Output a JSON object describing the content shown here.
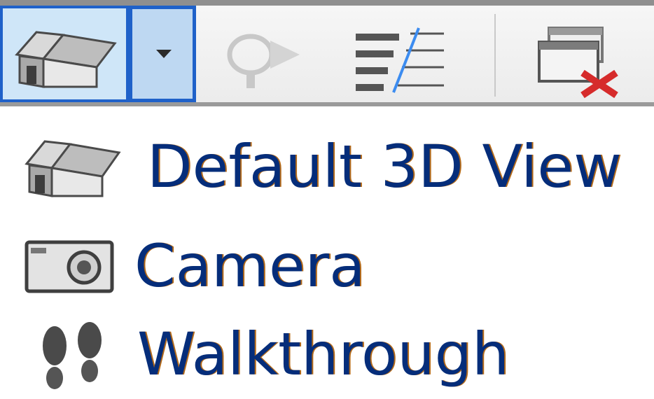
{
  "toolbar": {
    "buttons": [
      {
        "icon": "house-icon",
        "active": true
      },
      {
        "icon": "dropdown-arrow-icon",
        "active": true
      },
      {
        "icon": "section-view-icon",
        "enabled": false
      },
      {
        "icon": "thin-lines-icon"
      },
      {
        "icon": "close-hidden-windows-icon"
      }
    ]
  },
  "menu": {
    "items": [
      {
        "label": "Default 3D View",
        "icon": "house-icon"
      },
      {
        "label": "Camera",
        "icon": "camera-icon"
      },
      {
        "label": "Walkthrough",
        "icon": "footprints-icon"
      }
    ]
  },
  "colors": {
    "text": "#052d7a",
    "highlight_border": "#1f61c9",
    "highlight_fill": "#cfe6f8",
    "thin_lines_accent": "#3c8cf0",
    "close_x": "#d62b2b"
  }
}
